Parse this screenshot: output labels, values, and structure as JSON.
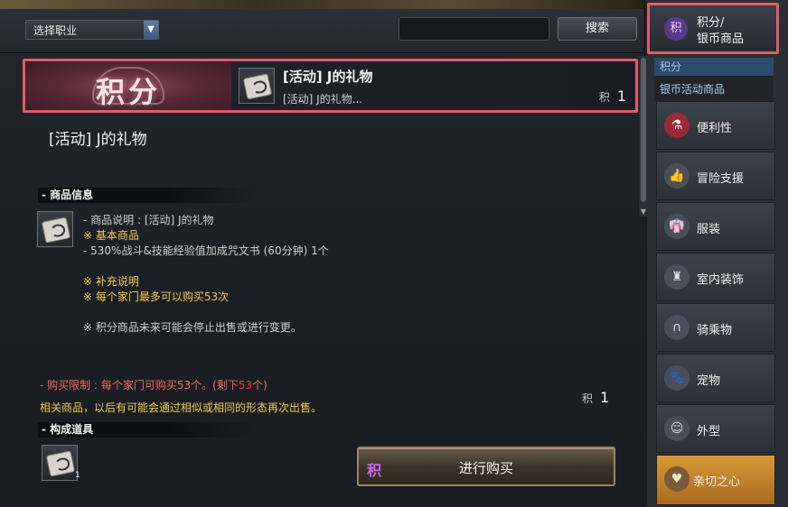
{
  "toolbar": {
    "job_select": "选择职业",
    "search_button": "搜索"
  },
  "item": {
    "banner": "积分",
    "name": "[活动] J的礼物",
    "short_desc": "[活动] J的礼物...",
    "currency_symbol": "积",
    "price": "1"
  },
  "detail": {
    "title": "[活动] J的礼物",
    "info_header": "- 商品信息",
    "lines": {
      "desc": "- 商品说明 : [活动] J的礼物",
      "basic": "※ 基本商品",
      "content": "- 530%战斗&技能经验值加成咒文书 (60分钟) 1个",
      "extra": "※ 补充说明",
      "limit": "※ 每个家门最多可以购买53次",
      "notice": "※ 积分商品未来可能会停止出售或进行变更。"
    },
    "purchase_limit_prefix": "- 购买限制 : 每个家门可购买53个。(剩下",
    "purchase_limit_remaining": "53",
    "purchase_limit_suffix": "个)",
    "resale_note": "相关商品，以后有可能会通过相似或相同的形态再次出售。",
    "price_symbol": "积",
    "price": "1",
    "components_header": "- 构成道具",
    "component_qty": "1",
    "buy_symbol": "积",
    "buy_button": "进行购买"
  },
  "sidebar": {
    "top_icon": "积",
    "top_label_1": "积分/",
    "top_label_2": "银币商品",
    "tree_selected": "积分",
    "tree_sub": "银币活动商品",
    "categories": [
      {
        "label": "便利性",
        "icon": "potion-icon"
      },
      {
        "label": "冒险支援",
        "icon": "thumbs-up-icon"
      },
      {
        "label": "服装",
        "icon": "clothes-icon"
      },
      {
        "label": "室内装饰",
        "icon": "chair-icon"
      },
      {
        "label": "骑乘物",
        "icon": "horseshoe-icon"
      },
      {
        "label": "宠物",
        "icon": "paw-icon"
      },
      {
        "label": "外型",
        "icon": "appearance-icon"
      },
      {
        "label": "亲切之心",
        "icon": "heart-icon"
      }
    ]
  },
  "colors": {
    "highlight_border": "#e25b6a",
    "gold_text": "#f2c94c",
    "warning_text": "#f06a5a",
    "selected_category": "#d89a38"
  }
}
